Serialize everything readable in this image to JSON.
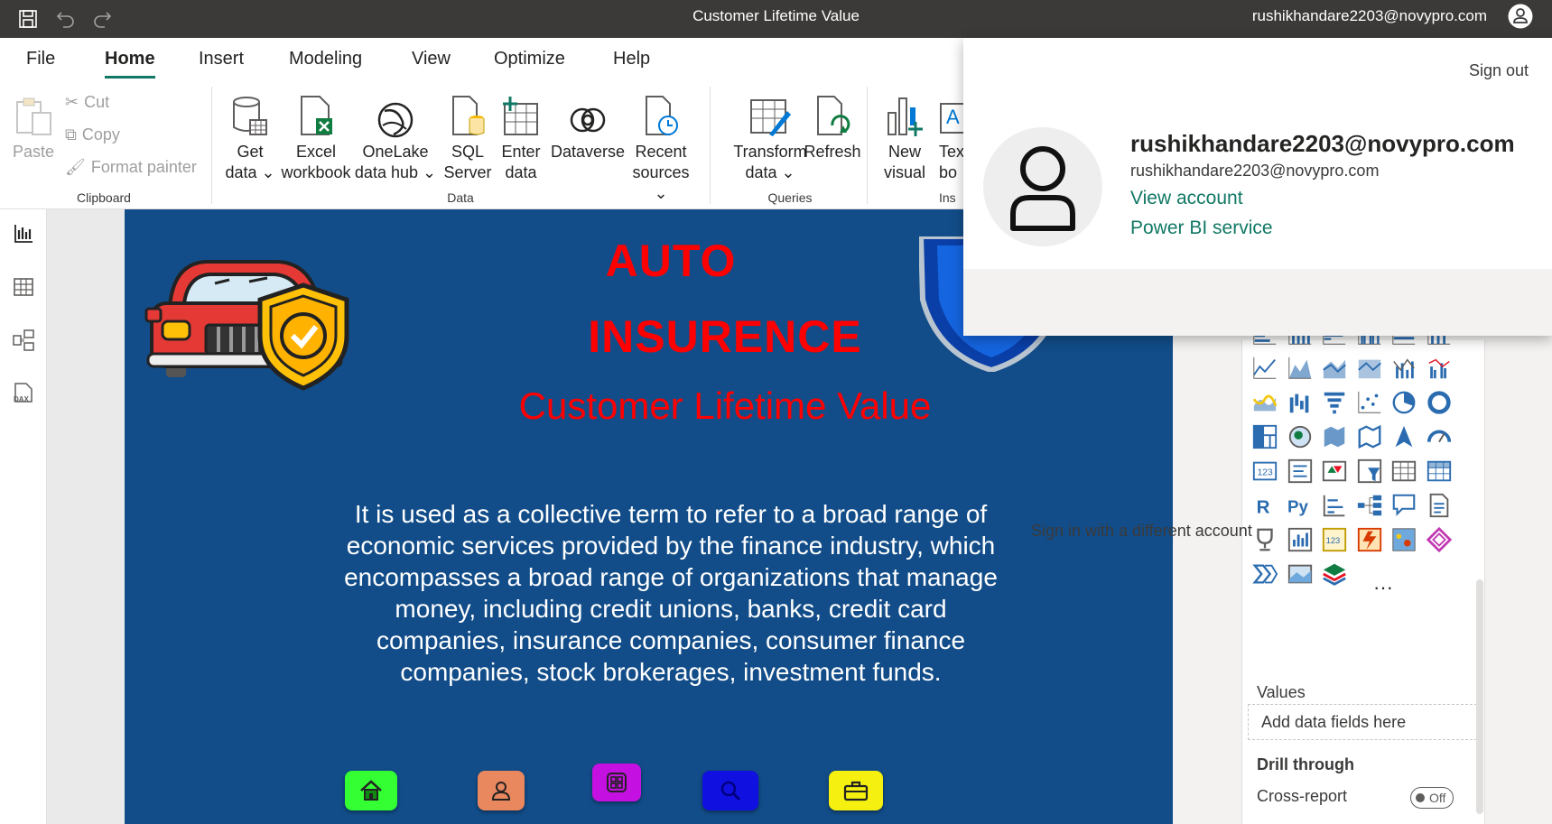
{
  "titlebar": {
    "title": "Customer Lifetime Value",
    "user_email": "rushikhandare2203@novypro.com"
  },
  "menu": {
    "tabs": [
      "File",
      "Home",
      "Insert",
      "Modeling",
      "View",
      "Optimize",
      "Help"
    ],
    "active": "Home"
  },
  "ribbon": {
    "clipboard": {
      "paste": "Paste",
      "cut": "Cut",
      "copy": "Copy",
      "format_painter": "Format painter",
      "label": "Clipboard"
    },
    "data": {
      "get_data": [
        "Get",
        "data ⌄"
      ],
      "excel": [
        "Excel",
        "workbook"
      ],
      "onelake": [
        "OneLake",
        "data hub ⌄"
      ],
      "sql": [
        "SQL",
        "Server"
      ],
      "enter": [
        "Enter",
        "data"
      ],
      "dataverse": [
        "Dataverse",
        ""
      ],
      "recent": [
        "Recent",
        "sources ⌄"
      ],
      "label": "Data"
    },
    "queries": {
      "transform": [
        "Transform",
        "data ⌄"
      ],
      "refresh": [
        "Refresh",
        ""
      ],
      "label": "Queries"
    },
    "insert": {
      "new_visual": [
        "New",
        "visual"
      ],
      "text_box": [
        "Tex",
        "bo"
      ],
      "label": "Ins"
    }
  },
  "report": {
    "heading1": "AUTO",
    "heading2": "INSURENCE",
    "heading3": "Customer Lifetime Value",
    "description": "It is used as a collective term to refer to a broad range of economic services provided by the finance industry, which encompasses a broad range of organizations that manage money, including credit unions, banks, credit card companies, insurance companies, consumer finance companies, stock brokerages, investment funds.",
    "nav_colors": [
      "#33ff33",
      "#e9875f",
      "#c410e0",
      "#1010e0",
      "#f5f00f"
    ]
  },
  "panes": {
    "collapsed_label": "s",
    "values_label": "Values",
    "add_fields": "Add data fields here",
    "drill_through": "Drill through",
    "cross_report": "Cross-report",
    "cross_report_state": "Off",
    "more": "···"
  },
  "account": {
    "sign_out": "Sign out",
    "name": "rushikhandare2203@novypro.com",
    "email": "rushikhandare2203@novypro.com",
    "view_account": "View account",
    "power_bi_service": "Power BI service",
    "different_account": "Sign in with a different account"
  },
  "colors": {
    "accent": "#117865",
    "titlebar": "#3b3a39",
    "report_bg": "#124d89",
    "heading": "#ff0000"
  }
}
